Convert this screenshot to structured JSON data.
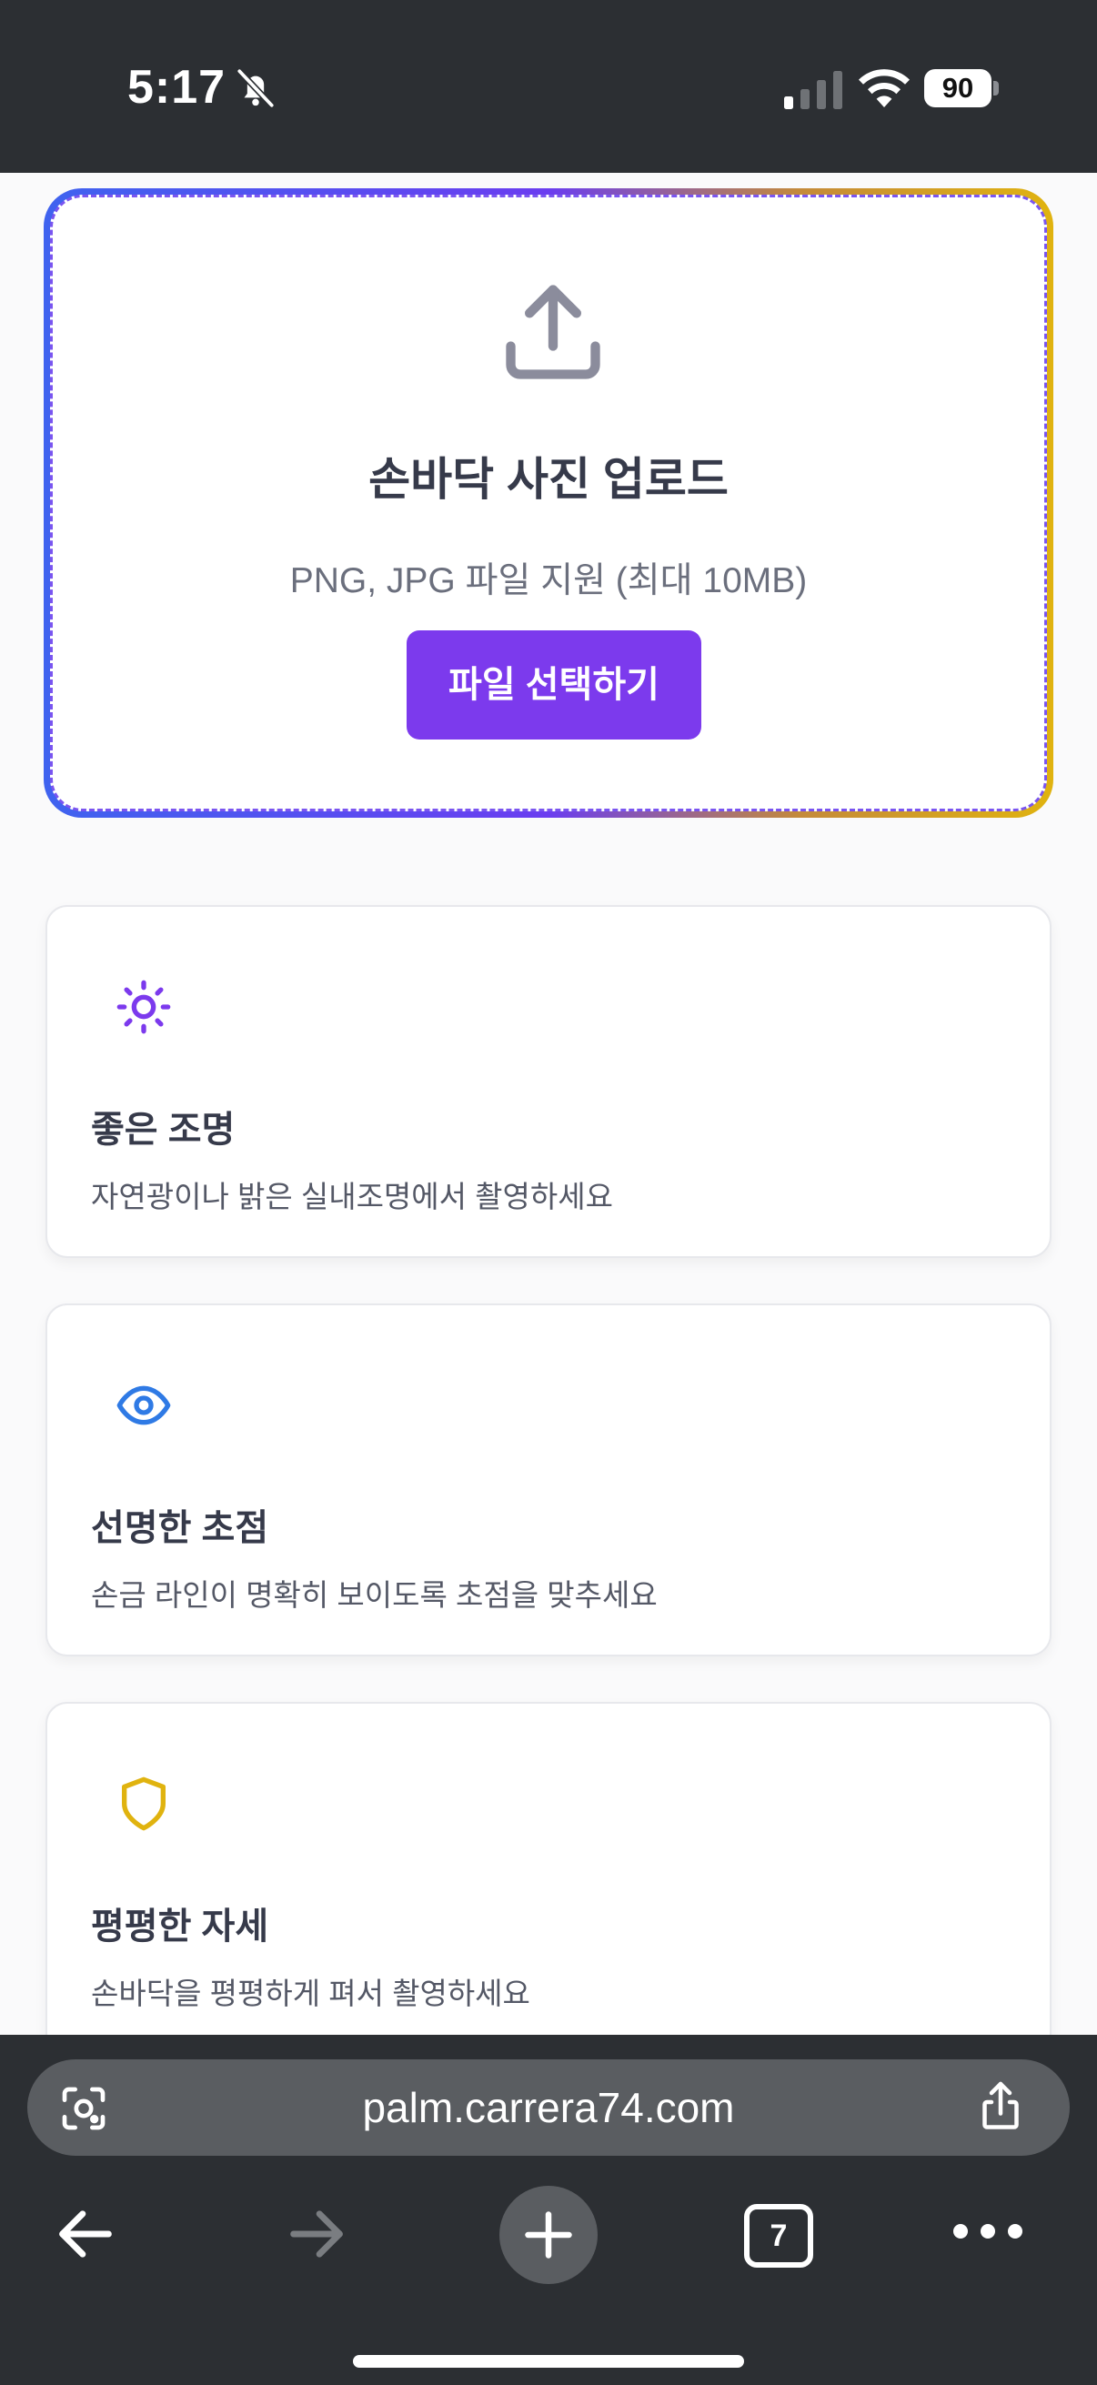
{
  "status_bar": {
    "time": "5:17",
    "battery": "90",
    "icons": [
      "bell-off-icon",
      "cellular-signal-icon",
      "wifi-icon",
      "battery-icon"
    ]
  },
  "upload": {
    "icon": "upload-icon",
    "title": "손바닥 사진 업로드",
    "description": "PNG, JPG 파일 지원 (최대 10MB)",
    "button_label": "파일 선택하기",
    "colors": {
      "button": "#7c3aed",
      "gradient_start": "#3f63ef",
      "gradient_mid": "#6a3df0",
      "gradient_end": "#e0b30f"
    }
  },
  "tips": [
    {
      "icon": "sun-icon",
      "color": "#7c3aed",
      "title": "좋은 조명",
      "description": "자연광이나 밝은 실내조명에서 촬영하세요"
    },
    {
      "icon": "eye-icon",
      "color": "#2f7ae5",
      "title": "선명한 초점",
      "description": "손금 라인이 명확히 보이도록 초점을 맞추세요"
    },
    {
      "icon": "shield-icon",
      "color": "#e0b30f",
      "title": "평평한 자세",
      "description": "손바닥을 평평하게 펴서 촬영하세요"
    }
  ],
  "browser": {
    "url": "palm.carrera74.com",
    "tab_count": "7",
    "icons": [
      "lens-icon",
      "share-icon",
      "back-arrow-icon",
      "forward-arrow-icon",
      "plus-icon",
      "tabs-icon",
      "more-icon"
    ]
  }
}
